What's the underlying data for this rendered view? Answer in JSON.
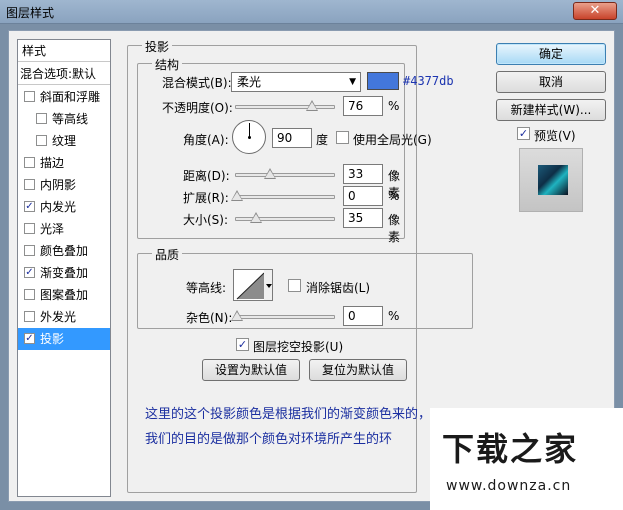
{
  "window": {
    "title": "图层样式",
    "close_glyph": "✕"
  },
  "sidebar": {
    "header": "样式",
    "blend_options": "混合选项:默认",
    "items": [
      {
        "label": "斜面和浮雕",
        "checked": false,
        "indent": false
      },
      {
        "label": "等高线",
        "checked": false,
        "indent": true
      },
      {
        "label": "纹理",
        "checked": false,
        "indent": true
      },
      {
        "label": "描边",
        "checked": false,
        "indent": false
      },
      {
        "label": "内阴影",
        "checked": false,
        "indent": false
      },
      {
        "label": "内发光",
        "checked": true,
        "indent": false
      },
      {
        "label": "光泽",
        "checked": false,
        "indent": false
      },
      {
        "label": "颜色叠加",
        "checked": false,
        "indent": false
      },
      {
        "label": "渐变叠加",
        "checked": true,
        "indent": false
      },
      {
        "label": "图案叠加",
        "checked": false,
        "indent": false
      },
      {
        "label": "外发光",
        "checked": false,
        "indent": false
      },
      {
        "label": "投影",
        "checked": true,
        "indent": false,
        "active": true
      }
    ],
    "check_glyph": "✓"
  },
  "drop_shadow": {
    "title": "投影",
    "structure": {
      "title": "结构",
      "blend_mode_label": "混合模式(B):",
      "blend_mode_value": "柔光",
      "color_hex": "#4377db",
      "opacity_label": "不透明度(O):",
      "opacity_value": "76",
      "opacity_fraction": 0.76,
      "percent": "%",
      "angle_label": "角度(A):",
      "angle_value": "90",
      "degree_unit": "度",
      "global_light_label": "使用全局光(G)",
      "global_light_checked": false,
      "distance_label": "距离(D):",
      "distance_value": "33",
      "spread_label": "扩展(R):",
      "spread_value": "0",
      "size_label": "大小(S):",
      "size_value": "35",
      "pixel_unit": "像素"
    },
    "quality": {
      "title": "品质",
      "contour_label": "等高线:",
      "anti_alias_label": "消除锯齿(L)",
      "anti_alias_checked": false,
      "noise_label": "杂色(N):",
      "noise_value": "0"
    },
    "knockout_label": "图层挖空投影(U)",
    "knockout_checked": true,
    "make_default": "设置为默认值",
    "reset_default": "复位为默认值"
  },
  "buttons": {
    "ok": "确定",
    "cancel": "取消",
    "new_style": "新建样式(W)...",
    "preview_label": "预览(V)",
    "preview_checked": true
  },
  "annotation": {
    "line1": "这里的这个投影颜色是根据我们的渐变颜色来的，",
    "line2": "我们的目的是做那个颜色对环境所产生的环"
  },
  "watermark": {
    "title": "下载之家",
    "url": "www.downza.cn"
  },
  "colors": {
    "accent": "#4377db",
    "selection": "#3399ff",
    "note_text": "#1b2fa0"
  }
}
